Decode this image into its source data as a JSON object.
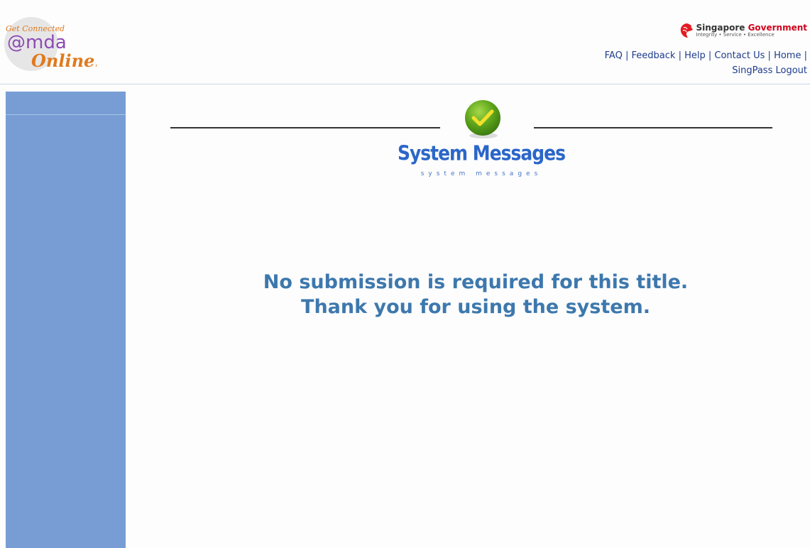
{
  "logo": {
    "tagline": "Get Connected",
    "brand": "@mda",
    "sub": "Online!"
  },
  "gov_logo": {
    "name_part1": "Singapore ",
    "name_part2": "Government",
    "tagline": "Integrity • Service • Excellence",
    "accent": "#d0021b"
  },
  "nav": {
    "faq": "FAQ",
    "feedback": "Feedback",
    "help": "Help",
    "contact": "Contact Us",
    "home": "Home",
    "logout": "SingPass Logout",
    "separator": "|"
  },
  "banner": {
    "title": "System Messages",
    "subtitle": "system messages",
    "icon": "check-icon"
  },
  "message": {
    "line1": "No submission is required for this title.",
    "line2": "Thank you for using the system."
  },
  "colors": {
    "sidebar": "#779dd4",
    "title": "#2b66c9",
    "message": "#3d78ad",
    "links": "#1e3c8c"
  }
}
